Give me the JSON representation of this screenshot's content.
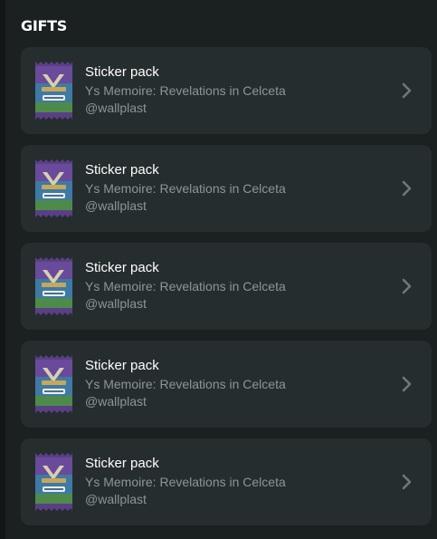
{
  "section": {
    "title": "GIFTS"
  },
  "gifts": [
    {
      "title": "Sticker pack",
      "game": "Ys Memoire: Revelations in Celceta",
      "user": "@wallplast"
    },
    {
      "title": "Sticker pack",
      "game": "Ys Memoire: Revelations in Celceta",
      "user": "@wallplast"
    },
    {
      "title": "Sticker pack",
      "game": "Ys Memoire: Revelations in Celceta",
      "user": "@wallplast"
    },
    {
      "title": "Sticker pack",
      "game": "Ys Memoire: Revelations in Celceta",
      "user": "@wallplast"
    },
    {
      "title": "Sticker pack",
      "game": "Ys Memoire: Revelations in Celceta",
      "user": "@wallplast"
    }
  ],
  "icons": {
    "pack": "sticker-pack-icon",
    "chevron": "chevron-right-icon"
  },
  "colors": {
    "background": "#1b2021",
    "card": "#262d2e",
    "title_text": "#ffffff",
    "secondary_text": "#8d9596",
    "chevron": "#6f7879"
  }
}
